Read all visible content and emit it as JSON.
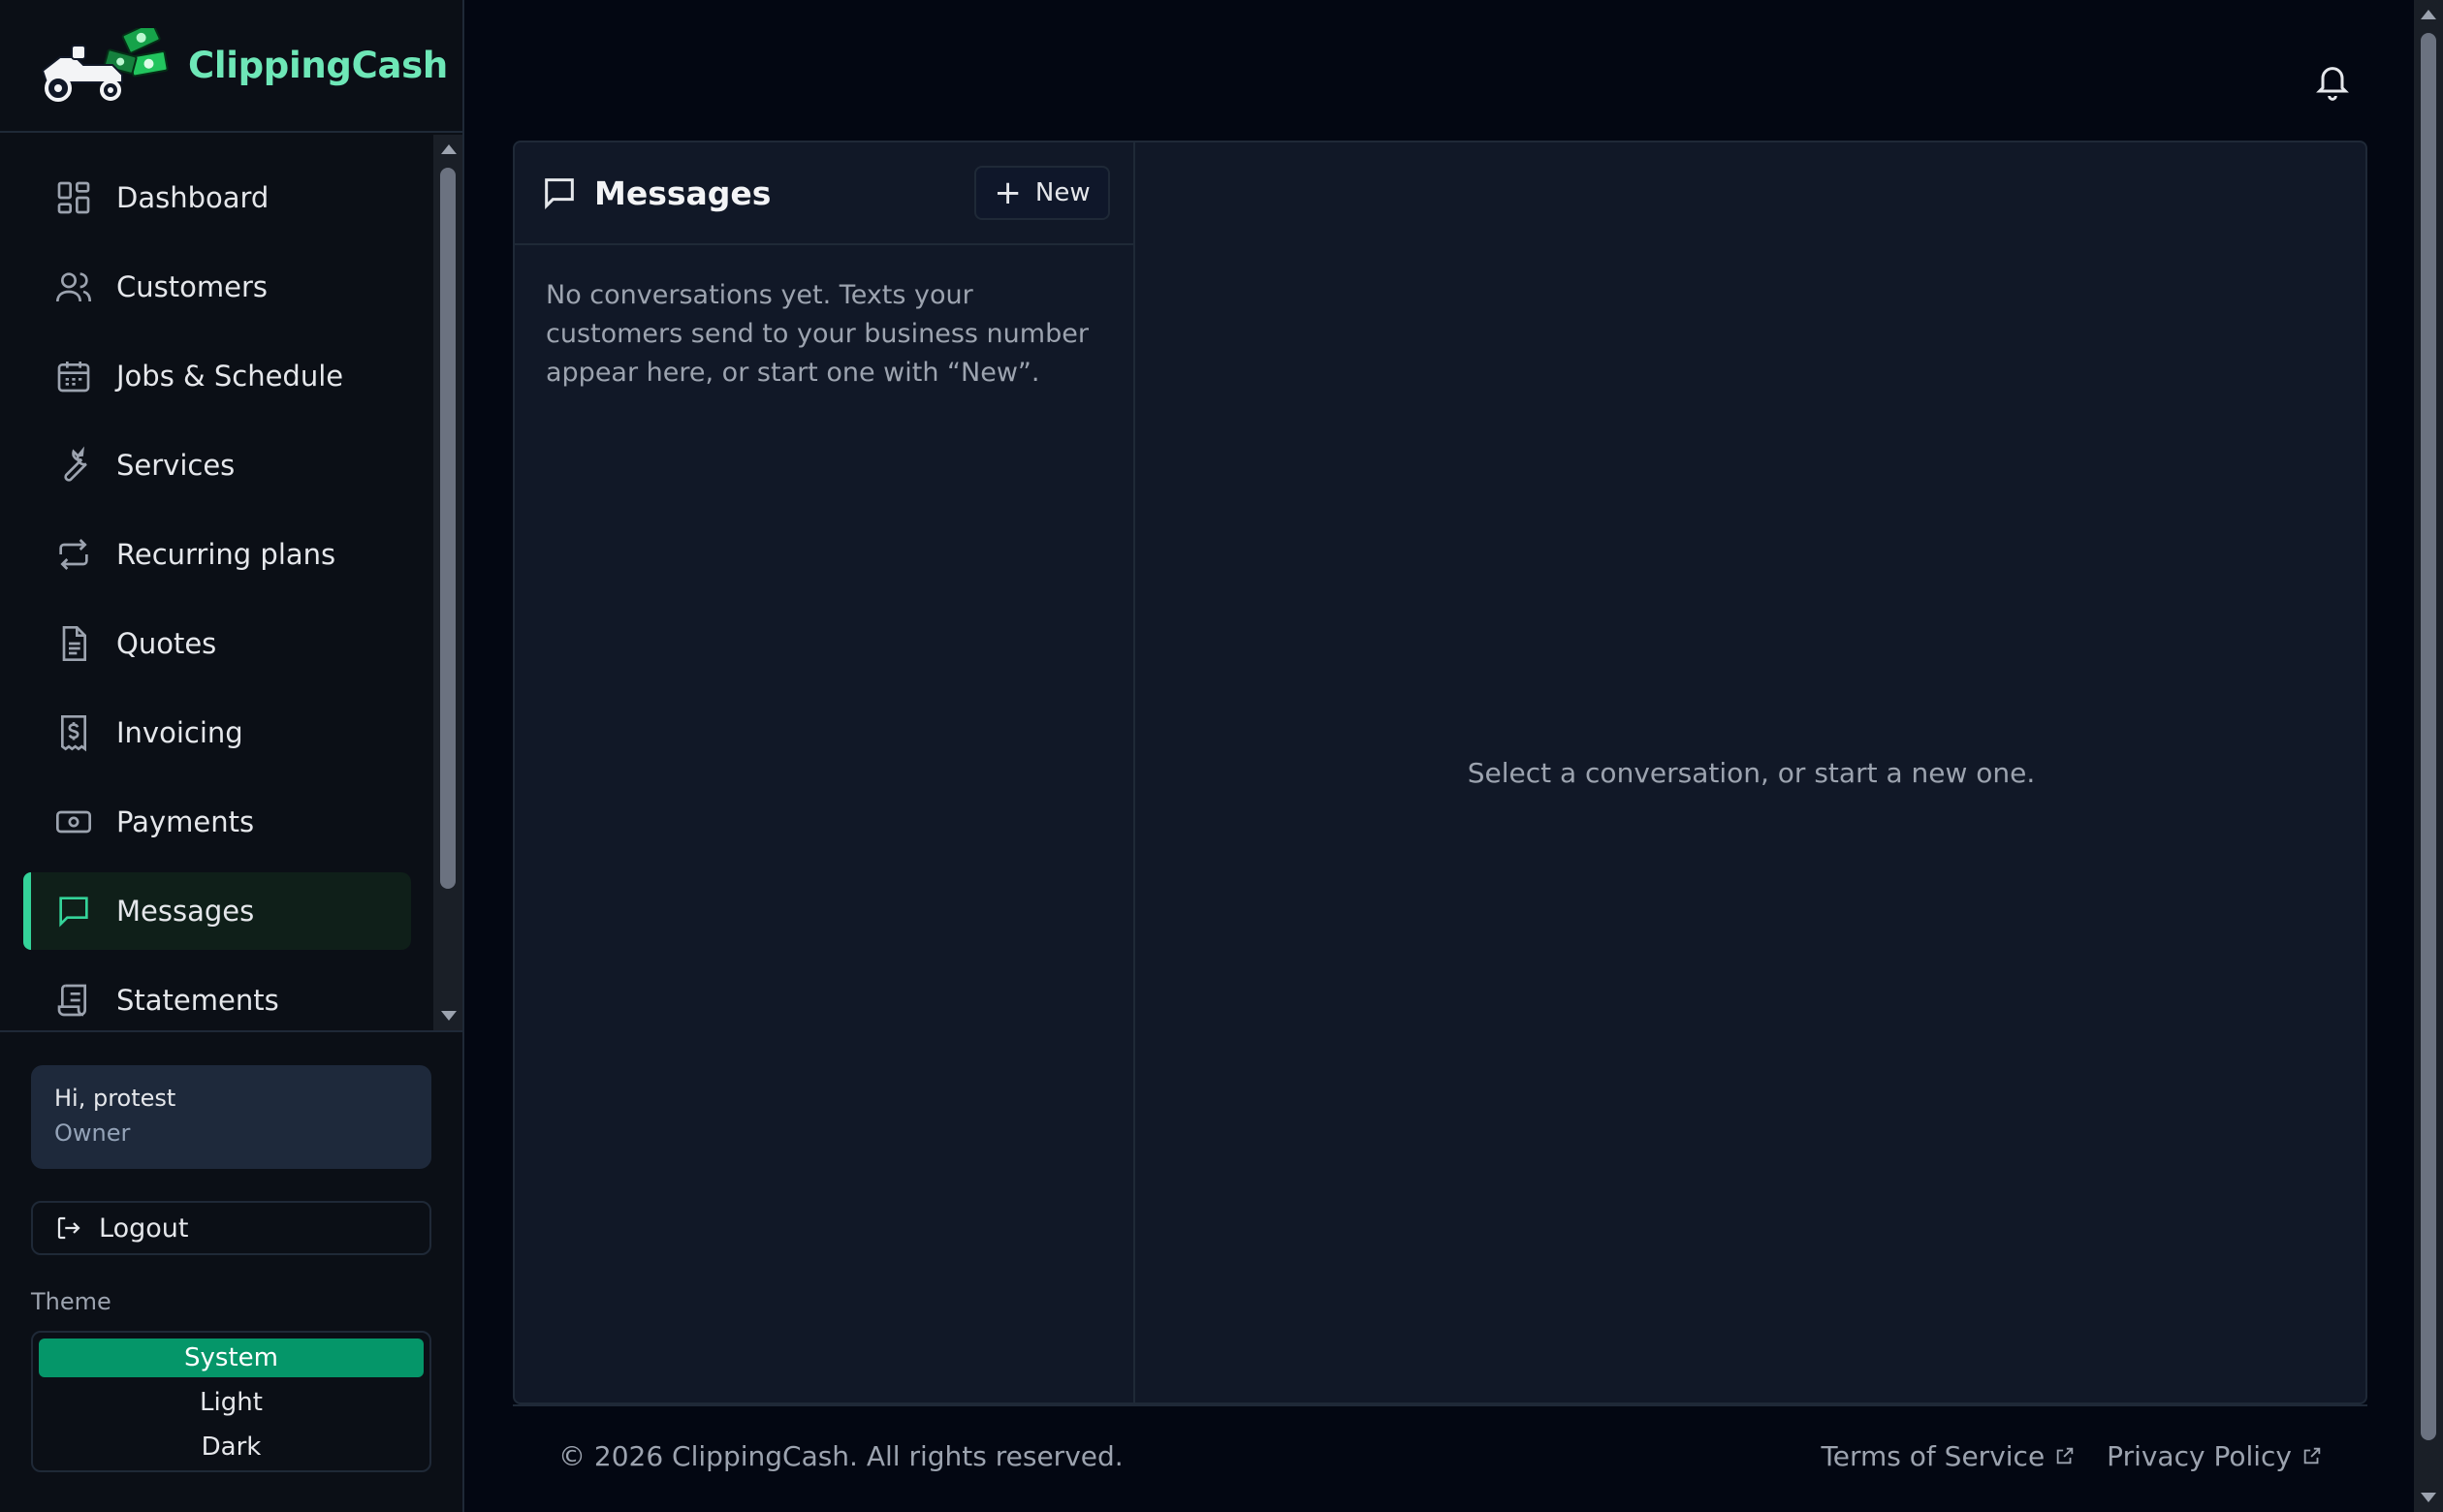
{
  "brand": {
    "name": "ClippingCash",
    "accent": "#6ee7b7"
  },
  "sidebar": {
    "items": [
      {
        "label": "Dashboard",
        "icon": "dashboard-icon"
      },
      {
        "label": "Customers",
        "icon": "users-icon"
      },
      {
        "label": "Jobs & Schedule",
        "icon": "calendar-icon"
      },
      {
        "label": "Services",
        "icon": "wrench-icon"
      },
      {
        "label": "Recurring plans",
        "icon": "repeat-icon"
      },
      {
        "label": "Quotes",
        "icon": "document-icon"
      },
      {
        "label": "Invoicing",
        "icon": "receipt-icon"
      },
      {
        "label": "Payments",
        "icon": "cash-icon"
      },
      {
        "label": "Messages",
        "icon": "message-icon",
        "active": true
      },
      {
        "label": "Statements",
        "icon": "scroll-icon"
      }
    ],
    "user": {
      "greeting": "Hi, protest",
      "role": "Owner"
    },
    "logout_label": "Logout",
    "theme": {
      "label": "Theme",
      "options": [
        "System",
        "Light",
        "Dark"
      ],
      "selected": "System",
      "selected_color": "#059669"
    }
  },
  "header": {
    "notifications_icon": "bell-icon"
  },
  "messages": {
    "title": "Messages",
    "new_label": "New",
    "empty_list_text": "No conversations yet. Texts your customers send to your business number appear here, or start one with “New”.",
    "empty_detail_text": "Select a conversation, or start a new one."
  },
  "footer": {
    "copyright": "© 2026 ClippingCash. All rights reserved.",
    "links": [
      "Terms of Service",
      "Privacy Policy"
    ]
  }
}
